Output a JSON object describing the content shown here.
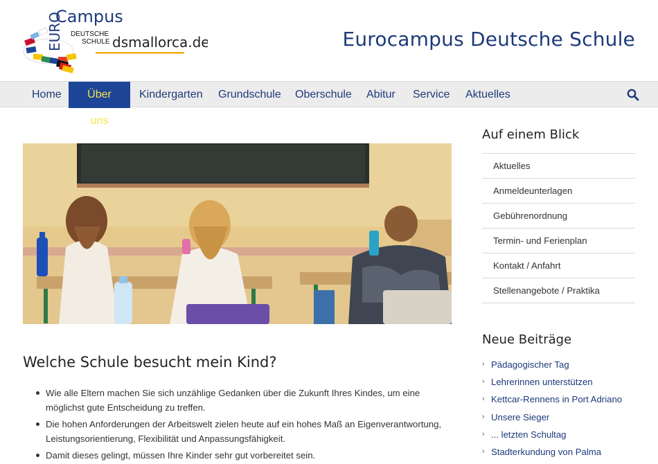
{
  "header": {
    "logo": {
      "line1": "Campus",
      "vertical": "EURO",
      "line2": "DEUTSCHE",
      "line3": "SCHULE",
      "domain": "dsmallorca.de"
    },
    "site_title": "Eurocampus Deutsche Schule"
  },
  "nav": {
    "items": [
      {
        "label": "Home"
      },
      {
        "label": "Über uns"
      },
      {
        "label": "Kindergarten"
      },
      {
        "label": "Grundschule"
      },
      {
        "label": "Oberschule"
      },
      {
        "label": "Abitur"
      },
      {
        "label": "Service"
      },
      {
        "label": "Aktuelles"
      }
    ],
    "active_index": 1,
    "search_icon": "search-icon"
  },
  "main": {
    "heading": "Welche Schule besucht mein Kind?",
    "bullets": [
      "Wie alle Eltern machen Sie sich unzählige Gedanken über die Zukunft Ihres Kindes, um eine möglichst gute Entscheidung zu treffen.",
      "Die hohen Anforderungen der Arbeitswelt zielen heute auf ein hohes Maß an Eigenverantwortung, Leistungsorientierung, Flexibilität und Anpassungsfähigkeit.",
      "Damit dieses gelingt, müssen Ihre Kinder sehr gut vorbereitet sein."
    ]
  },
  "sidebar": {
    "glance_heading": "Auf einem Blick",
    "glance_items": [
      "Aktuelles",
      "Anmeldeunterlagen",
      "Gebührenordnung",
      "Termin- und Ferienplan",
      "Kontakt / Anfahrt",
      "Stellenangebote / Praktika"
    ],
    "news_heading": "Neue Beiträge",
    "news_items": [
      "Pädagogischer Tag",
      "Lehrerinnen unterstützen",
      "Kettcar-Rennens in Port Adriano",
      "Unsere Sieger",
      "... letzten Schultag",
      "Stadterkundung von Palma"
    ]
  },
  "colors": {
    "brand_blue": "#1d3a7a",
    "active_nav_bg": "#1d4597",
    "active_nav_text": "#f6e34a",
    "nav_bg": "#ececec"
  }
}
